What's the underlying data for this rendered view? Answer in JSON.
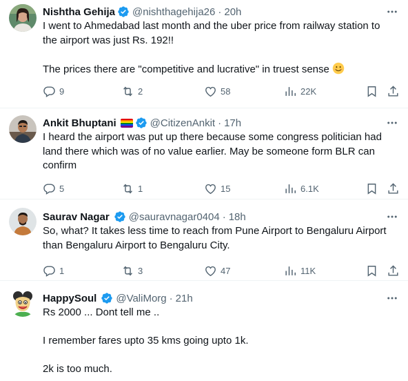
{
  "colors": {
    "verified": "#1d9bf0",
    "text": "#0f1419",
    "muted": "#536471",
    "divider": "#eff3f4"
  },
  "tweets": [
    {
      "name": "Nishtha Gehija",
      "handle": "@nishthagehija26",
      "time": "20h",
      "lines": [
        "I went to Ahmedabad last month and the uber price from railway station to",
        "the airport was just Rs. 192!!",
        "",
        "The prices there are \"competitive and lucrative\" in truest sense"
      ],
      "emoji": "smiling-face-emoji",
      "replies": "9",
      "reposts": "2",
      "likes": "58",
      "views": "22K"
    },
    {
      "name": "Ankit Bhuptani",
      "handle": "@CitizenAnkit",
      "time": "17h",
      "lines": [
        "I heard the airport was put up there because some congress politician had",
        "land there which was of no value earlier. May be someone form BLR can",
        "confirm"
      ],
      "replies": "5",
      "reposts": "1",
      "likes": "15",
      "views": "6.1K"
    },
    {
      "name": "Saurav Nagar",
      "handle": "@sauravnagar0404",
      "time": "18h",
      "lines": [
        "So, what? It takes less time to reach from Pune Airport to Bengaluru Airport",
        "than Bengaluru Airport to Bengaluru City."
      ],
      "replies": "1",
      "reposts": "3",
      "likes": "47",
      "views": "11K"
    },
    {
      "name": "HappySoul",
      "handle": "@ValiMorg",
      "time": "21h",
      "lines": [
        "Rs 2000 ... Dont tell me ..",
        "",
        "I remember fares upto 35 kms going upto 1k.",
        "",
        "2k is too much."
      ]
    }
  ],
  "separator": "·"
}
